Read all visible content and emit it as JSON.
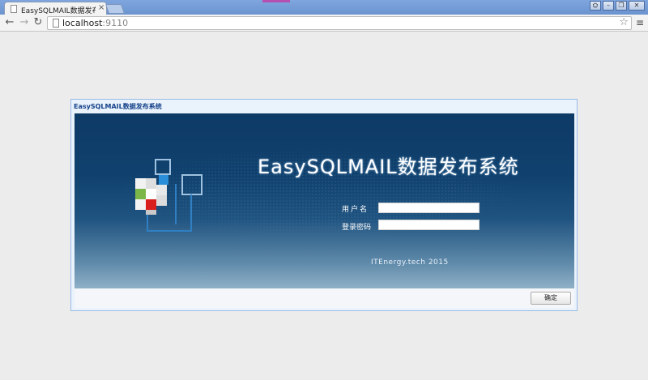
{
  "browser": {
    "tab_title": "EasySQLMAIL数据发布系",
    "tab_close": "×",
    "url_host": "localhost",
    "url_port": ":9110",
    "back_icon": "back-arrow-icon",
    "forward_icon": "forward-arrow-icon",
    "reload_icon": "reload-icon",
    "star_icon": "star-icon",
    "menu_icon": "hamburger-menu-icon"
  },
  "window": {
    "title": "EasySQLMAIL数据发布系统"
  },
  "banner": {
    "app_title": "EasySQLMAIL数据发布系统",
    "username_label": "用户名",
    "username_value": "",
    "password_label": "登录密码",
    "password_value": "",
    "footer": "ITEnergy.tech  2015"
  },
  "buttons": {
    "confirm": "确定"
  },
  "colors": {
    "banner_top": "#0e3a66",
    "banner_bottom": "#8fb0c7",
    "window_border": "#99bbe8",
    "window_title": "#15428b"
  }
}
